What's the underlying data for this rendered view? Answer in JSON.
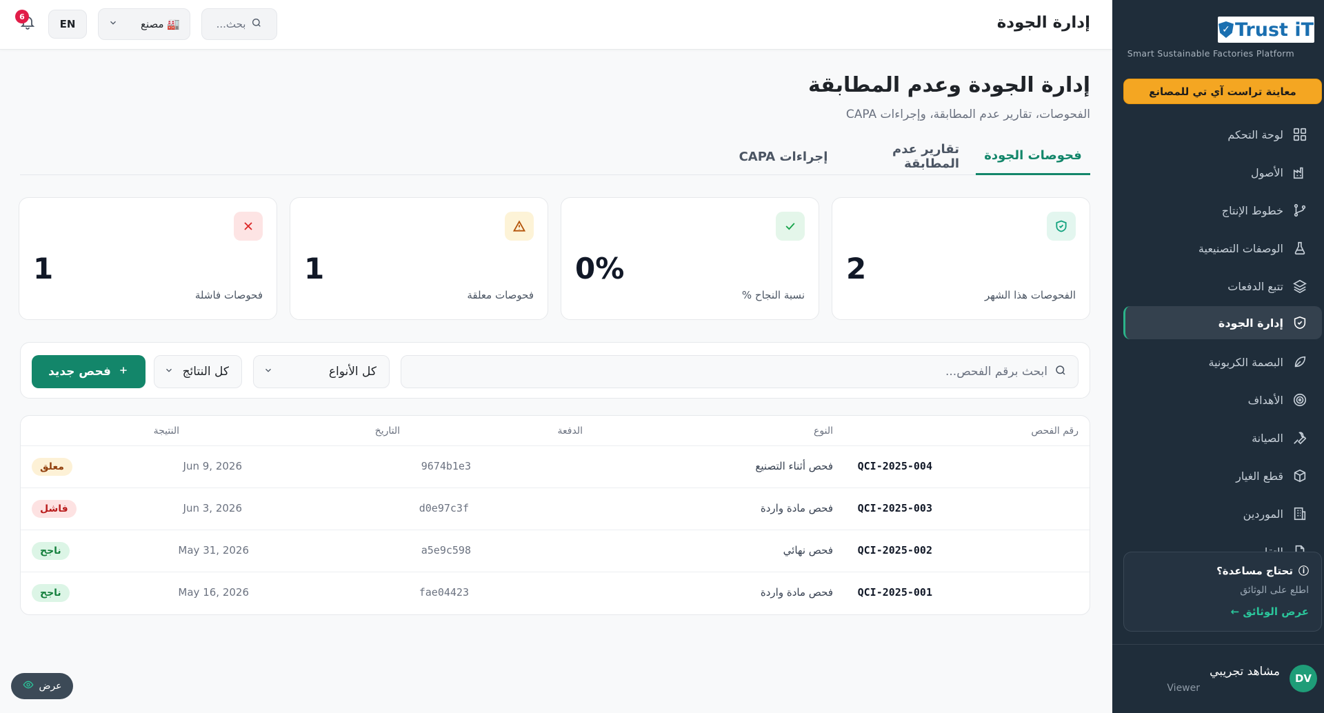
{
  "sidebar": {
    "logo_text": "Trust iT",
    "tagline": "Smart Sustainable Factories Platform",
    "promo_label": "معاينة تراست آي تي للمصانع",
    "items": [
      {
        "label": "لوحة التحكم",
        "icon": "grid-icon"
      },
      {
        "label": "الأصول",
        "icon": "factory-icon"
      },
      {
        "label": "خطوط الإنتاج",
        "icon": "git-branch-icon"
      },
      {
        "label": "الوصفات التصنيعية",
        "icon": "flask-icon"
      },
      {
        "label": "تتبع الدفعات",
        "icon": "layers-icon"
      },
      {
        "label": "إدارة الجودة",
        "icon": "shield-check-icon",
        "active": true
      },
      {
        "label": "البصمة الكربونية",
        "icon": "leaf-icon"
      },
      {
        "label": "الأهداف",
        "icon": "target-icon"
      },
      {
        "label": "الصيانة",
        "icon": "wrench-icon"
      },
      {
        "label": "قطع الغيار",
        "icon": "box-icon"
      },
      {
        "label": "الموردين",
        "icon": "building-icon"
      },
      {
        "label": "التقا",
        "icon": "file-icon"
      }
    ],
    "help": {
      "title": "تحتاج مساعدة؟",
      "subtitle": "اطلع على الوثائق",
      "link": "عرض الوثائق ←"
    },
    "user": {
      "initials": "DV",
      "name": "مشاهد تجريبي",
      "role": "Viewer"
    }
  },
  "topbar": {
    "title": "إدارة الجودة",
    "search_placeholder": "بحث...",
    "factory_label": "🏭 مصنع",
    "lang": "EN",
    "notifications_count": "6"
  },
  "page": {
    "title": "إدارة الجودة وعدم المطابقة",
    "subtitle": "الفحوصات، تقارير عدم المطابقة، وإجراءات CAPA"
  },
  "tabs": [
    {
      "label": "فحوصات الجودة",
      "active": true
    },
    {
      "label": "تقارير عدم المطابقة"
    },
    {
      "label": "إجراءات CAPA"
    }
  ],
  "stats": [
    {
      "label": "الفحوصات هذا الشهر",
      "value": "2",
      "icon": "shield-check-icon",
      "color": "#14a37f",
      "bg": "#e3f6ef"
    },
    {
      "label": "نسبة النجاح %",
      "value": "0%",
      "icon": "check-icon",
      "color": "#16a34a",
      "bg": "#e4f6ea"
    },
    {
      "label": "فحوصات معلقة",
      "value": "1",
      "icon": "warning-icon",
      "color": "#b45309",
      "bg": "#fdf3d7"
    },
    {
      "label": "فحوصات فاشلة",
      "value": "1",
      "icon": "close-icon",
      "color": "#dc2626",
      "bg": "#fde4e4"
    }
  ],
  "filters": {
    "search_placeholder": "ابحث برقم الفحص...",
    "type_label": "كل الأنواع",
    "result_label": "كل النتائج",
    "new_button": "فحص جديد"
  },
  "table": {
    "headers": {
      "id": "رقم الفحص",
      "type": "النوع",
      "batch": "الدفعة",
      "date": "التاريخ",
      "result": "النتيجة"
    },
    "rows": [
      {
        "id": "QCI-2025-004",
        "type": "فحص أثناء التصنيع",
        "batch": "9674b1e3",
        "date": "Jun 9, 2026",
        "result": "معلق",
        "status": "pending"
      },
      {
        "id": "QCI-2025-003",
        "type": "فحص مادة واردة",
        "batch": "d0e97c3f",
        "date": "Jun 3, 2026",
        "result": "فاشل",
        "status": "failed"
      },
      {
        "id": "QCI-2025-002",
        "type": "فحص نهائي",
        "batch": "a5e9c598",
        "date": "May 31, 2026",
        "result": "ناجح",
        "status": "passed"
      },
      {
        "id": "QCI-2025-001",
        "type": "فحص مادة واردة",
        "batch": "fae04423",
        "date": "May 16, 2026",
        "result": "ناجح",
        "status": "passed"
      }
    ]
  },
  "float_view_label": "عرض",
  "colors": {
    "accent": "#13866a",
    "sidebar_bg": "#1f2d3a",
    "promo": "#f4a622"
  }
}
